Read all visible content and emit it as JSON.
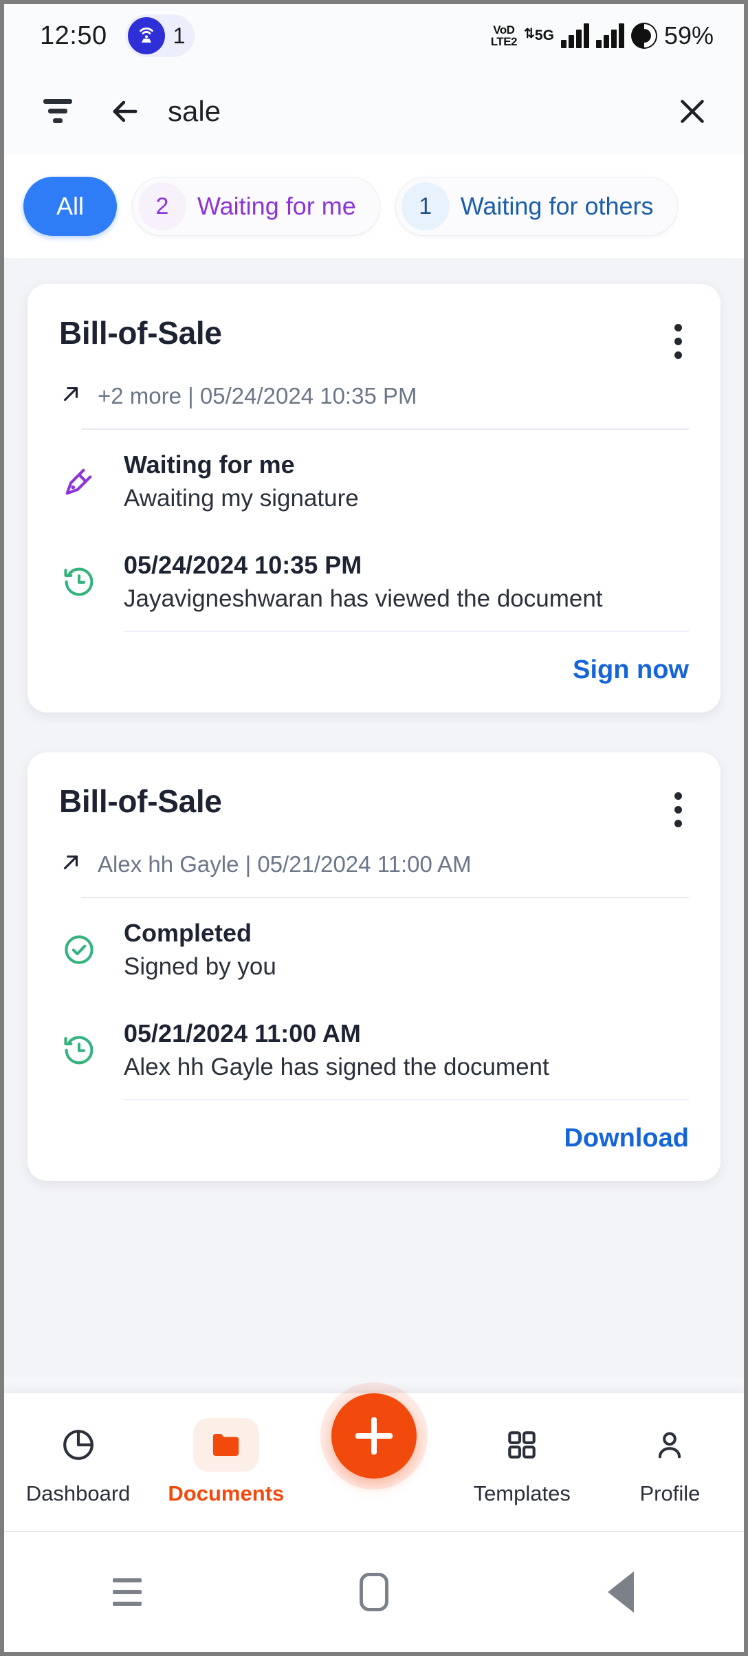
{
  "statusbar": {
    "time": "12:50",
    "hotspot_count": "1",
    "volte_line1": "VoD",
    "volte_line2": "LTE2",
    "network": "5G",
    "battery": "59%"
  },
  "header": {
    "search_value": "sale",
    "filter_icon": "filter-icon",
    "back_icon": "back-arrow-icon",
    "close_icon": "close-icon"
  },
  "chips": [
    {
      "label": "All",
      "count": "",
      "state": "active"
    },
    {
      "label": "Waiting for me",
      "count": "2",
      "state": "purple"
    },
    {
      "label": "Waiting for others",
      "count": "1",
      "state": "blue"
    }
  ],
  "cards": [
    {
      "title": "Bill-of-Sale",
      "subtitle": "+2 more | 05/24/2024 10:35 PM",
      "share_icon": "share-arrow-icon",
      "menu_icon": "kebab-menu-icon",
      "status": {
        "icon": "signature-pen-icon",
        "title": "Waiting for me",
        "subtitle": "Awaiting my signature"
      },
      "activity": {
        "icon": "history-clock-icon",
        "title": "05/24/2024 10:35 PM",
        "subtitle": "Jayavigneshwaran has viewed the document"
      },
      "action_label": "Sign now"
    },
    {
      "title": "Bill-of-Sale",
      "subtitle": "Alex hh Gayle | 05/21/2024 11:00 AM",
      "share_icon": "share-arrow-icon",
      "menu_icon": "kebab-menu-icon",
      "status": {
        "icon": "check-circle-icon",
        "title": "Completed",
        "subtitle": "Signed by you"
      },
      "activity": {
        "icon": "history-clock-icon",
        "title": "05/21/2024 11:00 AM",
        "subtitle": "Alex hh Gayle has signed the document"
      },
      "action_label": "Download"
    }
  ],
  "bottomnav": {
    "items": [
      {
        "label": "Dashboard",
        "icon": "pie-chart-icon",
        "active": false
      },
      {
        "label": "Documents",
        "icon": "folder-icon",
        "active": true
      },
      {
        "label": "Templates",
        "icon": "grid-icon",
        "active": false
      },
      {
        "label": "Profile",
        "icon": "person-icon",
        "active": false
      }
    ],
    "fab_icon": "plus-icon"
  },
  "androidnav": {
    "recents": "recents-icon",
    "home": "home-icon",
    "back": "back-icon"
  },
  "colors": {
    "accent_orange": "#f2490c",
    "link_blue": "#1565d8",
    "chip_blue": "#2e7cf6",
    "purple": "#8c35d6",
    "green": "#34b37e"
  }
}
